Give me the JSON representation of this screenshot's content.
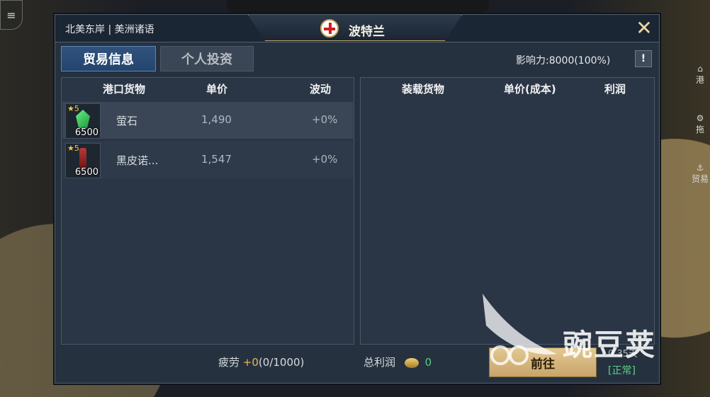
{
  "header": {
    "region": "北美东岸 | 美洲诸语",
    "port_name": "波特兰",
    "close_icon": "close-x-icon"
  },
  "tabs": [
    {
      "label": "贸易信息",
      "active": true
    },
    {
      "label": "个人投资",
      "active": false
    }
  ],
  "influence": "影响力:8000(100%)",
  "info_button": "!",
  "port_goods": {
    "columns": [
      "港口货物",
      "单价",
      "波动"
    ],
    "rows": [
      {
        "name": "萤石",
        "price": "1,490",
        "change": "+0%",
        "stars": "★5",
        "qty": "6500",
        "icon": "green-crystal-icon"
      },
      {
        "name": "黑皮诺...",
        "price": "1,547",
        "change": "+0%",
        "stars": "★5",
        "qty": "6500",
        "icon": "wine-bottle-icon"
      }
    ]
  },
  "cargo": {
    "columns": [
      "装载货物",
      "单价(成本)",
      "利润"
    ]
  },
  "footer": {
    "fatigue_label": "疲劳",
    "fatigue_delta": "+0",
    "fatigue_value": "(0/1000)",
    "profit_label": "总利润",
    "profit_value": "0",
    "go_label": "前往",
    "eta": "0.35天",
    "status": "[正常]"
  },
  "watermark": {
    "text": "豌豆荚"
  },
  "colors": {
    "accent_blue": "#2b4d78",
    "gold": "#c9a46a",
    "green": "#57d082"
  }
}
